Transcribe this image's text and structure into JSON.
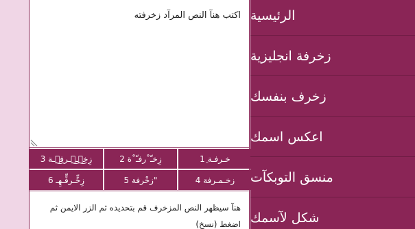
{
  "colors": {
    "accent": "#8a2556",
    "page_background": "#f0d6e6",
    "panel_background": "#ffffff"
  },
  "editor": {
    "input_text": "اكتب هنآ النص المرآد زخرفته",
    "output_text": "هنآ سيظهر النص المزخرف قم بتحديده ثم الزر الايمن ثم اضغط (نسخ)"
  },
  "style_buttons": [
    "خـرفـة 1ِ",
    "زِخـّ˚رفـّ˚ة 2",
    "زِخ๋͜ـ๋͜ـرف๋͜ـة 3",
    "زخـمـرفة 4",
    "زخْرفة 5\"",
    "زِخٍّـرفٍّـهِـ 6"
  ],
  "sidebar": {
    "items": [
      "الرئيسية",
      "زخرفة انجليزية",
      "زخرف بنفسك",
      "اعكس اسمك",
      "منسق التوبكآت",
      "شكل لآسمك"
    ]
  }
}
